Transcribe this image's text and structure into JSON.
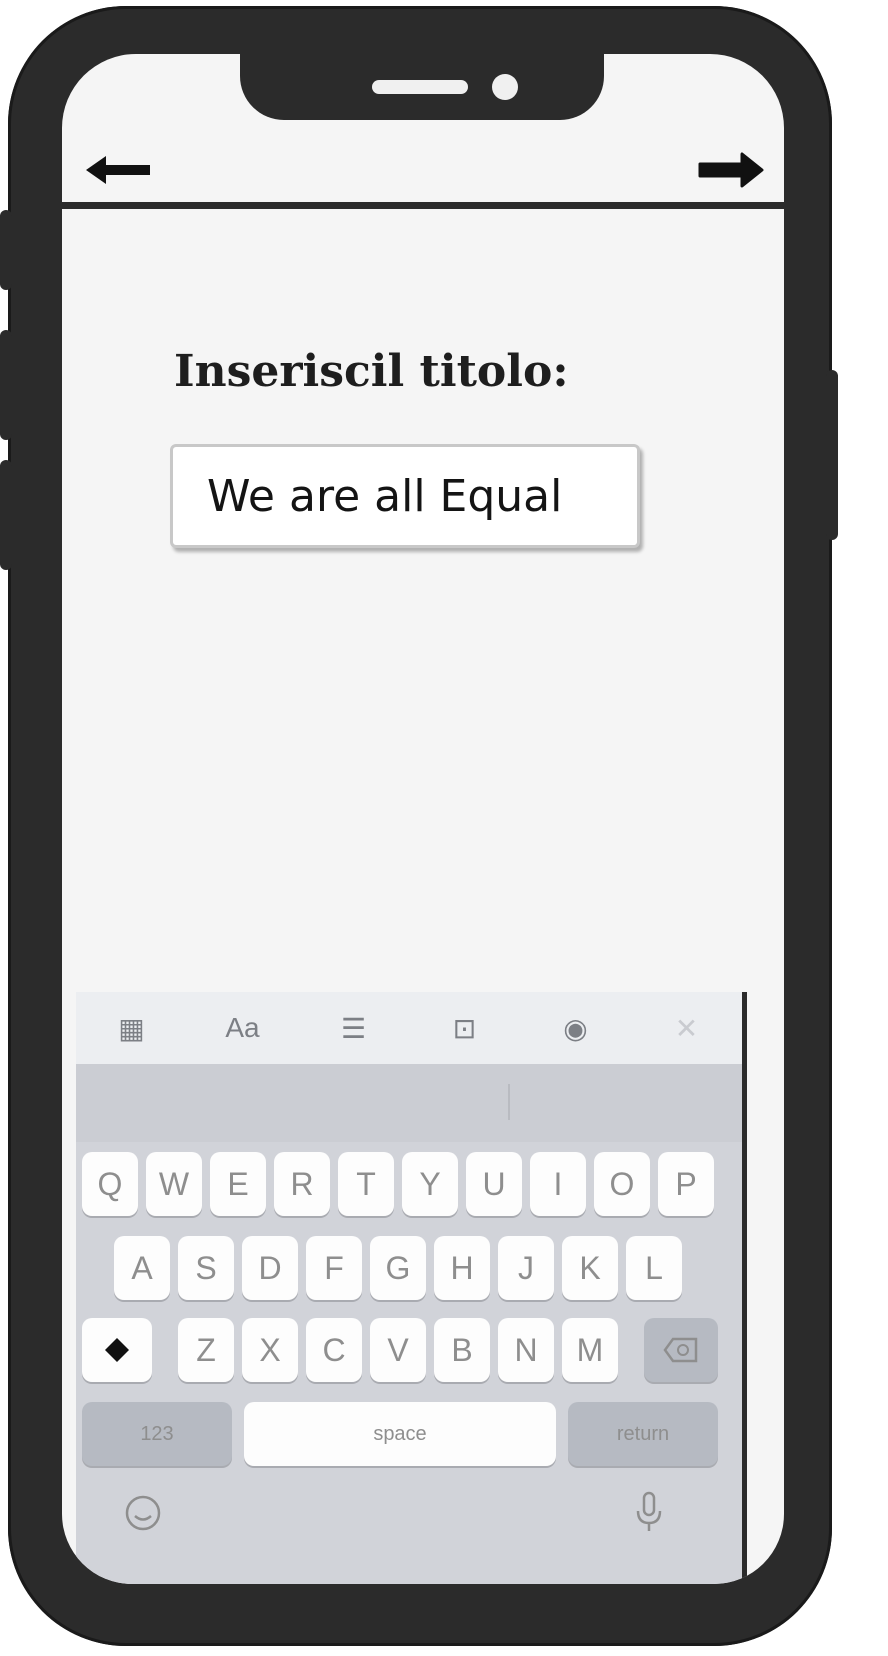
{
  "nav": {
    "back_icon": "arrow-left-icon",
    "forward_icon": "arrow-right-icon"
  },
  "prompt": {
    "label": "Inseriscil titolo:"
  },
  "input": {
    "value": "We are all Equal"
  },
  "keyboard": {
    "toolbar_icons": [
      "table-icon",
      "text-format-icon",
      "checklist-icon",
      "camera-icon",
      "pen-circle-icon",
      "close-icon"
    ],
    "toolbar_glyphs": [
      "▦",
      "Aa",
      "☰",
      "⊡",
      "◉",
      "✕"
    ],
    "row1": [
      "Q",
      "W",
      "E",
      "R",
      "T",
      "Y",
      "U",
      "I",
      "O",
      "P"
    ],
    "row2": [
      "A",
      "S",
      "D",
      "F",
      "G",
      "H",
      "J",
      "K",
      "L"
    ],
    "row3": [
      "Z",
      "X",
      "C",
      "V",
      "B",
      "N",
      "M"
    ],
    "numbers_label": "123",
    "space_label": "space",
    "return_label": "return",
    "shift_icon": "shift-icon",
    "delete_icon": "delete-icon",
    "emoji_icon": "emoji-icon",
    "mic_icon": "microphone-icon"
  },
  "colors": {
    "frame": "#2b2b2b",
    "screen": "#f5f5f5",
    "keyboard": "#d1d3d9"
  }
}
